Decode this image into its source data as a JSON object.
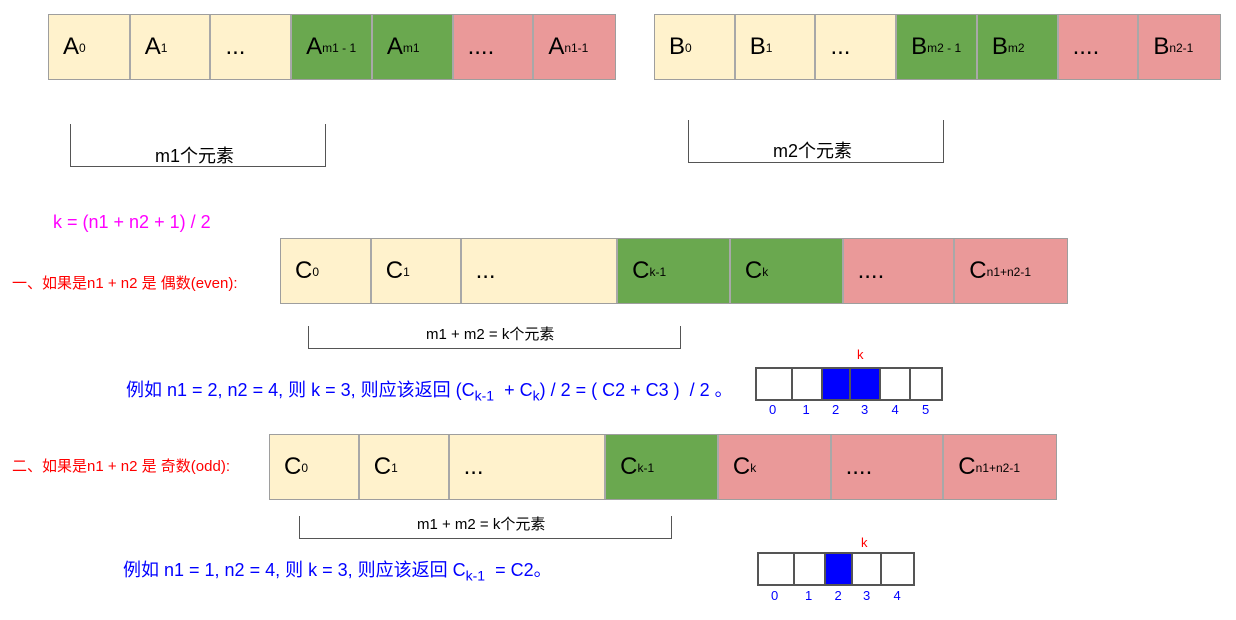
{
  "array_a": {
    "cells": [
      {
        "base": "A",
        "sub": "0",
        "color": "cream"
      },
      {
        "base": "A",
        "sub": "1",
        "color": "cream"
      },
      {
        "base": "...",
        "sub": "",
        "color": "cream"
      },
      {
        "base": "A",
        "sub": "m1 - 1",
        "color": "green"
      },
      {
        "base": "A",
        "sub": "m1",
        "color": "green"
      },
      {
        "base": "....",
        "sub": "",
        "color": "pink"
      },
      {
        "base": "A",
        "sub": "n1-1",
        "color": "pink"
      }
    ],
    "bracket_label": "m1个元素"
  },
  "array_b": {
    "cells": [
      {
        "base": "B",
        "sub": "0",
        "color": "cream"
      },
      {
        "base": "B",
        "sub": "1",
        "color": "cream"
      },
      {
        "base": "...",
        "sub": "",
        "color": "cream"
      },
      {
        "base": "B",
        "sub": "m2 - 1",
        "color": "green"
      },
      {
        "base": "B",
        "sub": "m2",
        "color": "green"
      },
      {
        "base": "....",
        "sub": "",
        "color": "pink"
      },
      {
        "base": "B",
        "sub": "n2-1",
        "color": "pink"
      }
    ],
    "bracket_label": "m2个元素"
  },
  "formula": "k = (n1 + n2 + 1) / 2",
  "even": {
    "label": "一、如果是n1 + n2 是 偶数(even):",
    "cells": [
      {
        "base": "C",
        "sub": "0",
        "color": "cream"
      },
      {
        "base": "C",
        "sub": "1",
        "color": "cream"
      },
      {
        "base": "...",
        "sub": "",
        "color": "cream"
      },
      {
        "base": "C",
        "sub": "k-1",
        "color": "green"
      },
      {
        "base": "C",
        "sub": "k",
        "color": "green"
      },
      {
        "base": "....",
        "sub": "",
        "color": "pink"
      },
      {
        "base": "C",
        "sub": "n1+n2-1",
        "color": "pink"
      }
    ],
    "bracket_label": "m1 + m2 = k个元素",
    "example": {
      "t1": "例如 n1 = 2, n2 = 4, 则 k = 3, 则应该返回 (C",
      "s1": "k-1",
      "t2": "  + C",
      "s2": "k",
      "t3": ") / 2 = ( C2 + C3 )  / 2 。"
    },
    "mini": {
      "k_label": "k",
      "indices": [
        "0",
        "1",
        "2",
        "3",
        "4",
        "5"
      ],
      "highlighted": [
        2,
        3
      ]
    }
  },
  "odd": {
    "label": "二、如果是n1 + n2 是 奇数(odd):",
    "cells": [
      {
        "base": "C",
        "sub": "0",
        "color": "cream"
      },
      {
        "base": "C",
        "sub": "1",
        "color": "cream"
      },
      {
        "base": "...",
        "sub": "",
        "color": "cream"
      },
      {
        "base": "C",
        "sub": "k-1",
        "color": "green"
      },
      {
        "base": "C",
        "sub": "k",
        "color": "pink"
      },
      {
        "base": "....",
        "sub": "",
        "color": "pink"
      },
      {
        "base": "C",
        "sub": "n1+n2-1",
        "color": "pink"
      }
    ],
    "bracket_label": "m1 + m2 = k个元素",
    "example": {
      "t1": "例如 n1 = 1, n2 = 4, 则 k = 3, 则应该返回 C",
      "s1": "k-1",
      "t2": "  = C2。"
    },
    "mini": {
      "k_label": "k",
      "indices": [
        "0",
        "1",
        "2",
        "3",
        "4"
      ],
      "highlighted": [
        2
      ]
    }
  },
  "colors": {
    "cream": "#fff2cc",
    "green": "#6aa84f",
    "pink": "#ea9999",
    "formula": "#ff00ff",
    "case_label": "#ff0000",
    "example": "#0000ff",
    "highlight": "#0000ff"
  }
}
